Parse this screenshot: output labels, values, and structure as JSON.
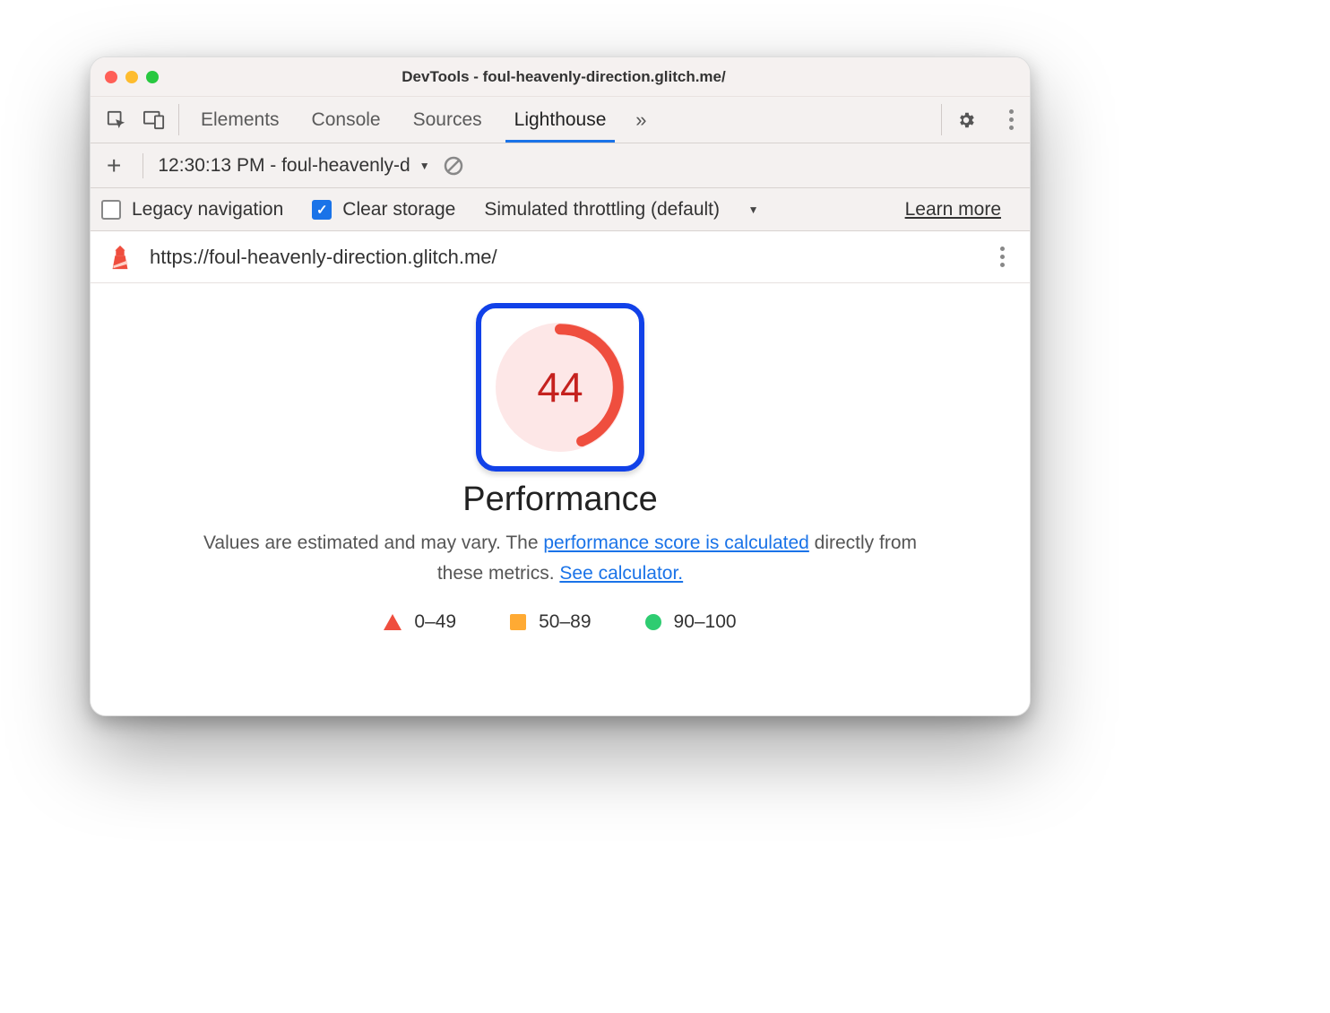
{
  "window": {
    "title": "DevTools - foul-heavenly-direction.glitch.me/"
  },
  "tabs": {
    "elements": "Elements",
    "console": "Console",
    "sources": "Sources",
    "lighthouse": "Lighthouse"
  },
  "optionbar": {
    "run_label": "12:30:13 PM - foul-heavenly-d"
  },
  "checkbar": {
    "legacy_nav": "Legacy navigation",
    "clear_storage": "Clear storage",
    "throttle": "Simulated throttling (default)",
    "learn_more": "Learn more"
  },
  "report": {
    "url": "https://foul-heavenly-direction.glitch.me/",
    "score": "44",
    "score_fraction": 0.44,
    "title": "Performance",
    "desc_prefix": "Values are estimated and may vary. The ",
    "link1": "performance score is calculated",
    "desc_mid": " directly from these metrics. ",
    "link2": "See calculator.",
    "legend": {
      "bad": "0–49",
      "mid": "50–89",
      "good": "90–100"
    },
    "colors": {
      "fail": "#ef4e3e",
      "warn": "#ffaa33",
      "pass": "#2ecc71",
      "highlight": "#1141e8"
    }
  }
}
